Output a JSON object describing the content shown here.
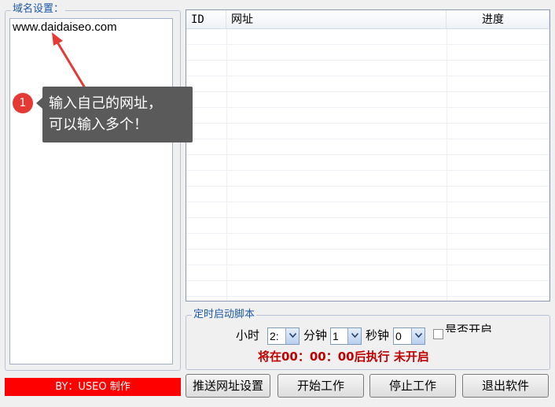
{
  "domain_settings": {
    "legend": "域名设置：",
    "urls": "www.daidaiseo.com"
  },
  "table": {
    "columns": [
      "ID",
      "网址",
      "进度"
    ],
    "rows": []
  },
  "timer": {
    "legend": "定时启动脚本",
    "hour_label": "小时",
    "hour_value": "2:",
    "minute_label": "分钟",
    "minute_value": "1",
    "second_label": "秒钟",
    "second_value": "0",
    "checkbox_label": "是否开启",
    "checked": false,
    "status": "将在00：00：00后执行  未开启"
  },
  "footer": {
    "by_label": "BY：USEO 制作",
    "push_button": "推送网址设置",
    "start_button": "开始工作",
    "stop_button": "停止工作",
    "exit_button": "退出软件"
  },
  "tooltip": {
    "step": "1",
    "line1": "输入自己的网址，",
    "line2": "可以输入多个！"
  },
  "colors": {
    "by_bar": "#ff0000",
    "status_text": "#c00000",
    "legend_text": "#1e5aa8",
    "tooltip_badge": "#e53935"
  }
}
